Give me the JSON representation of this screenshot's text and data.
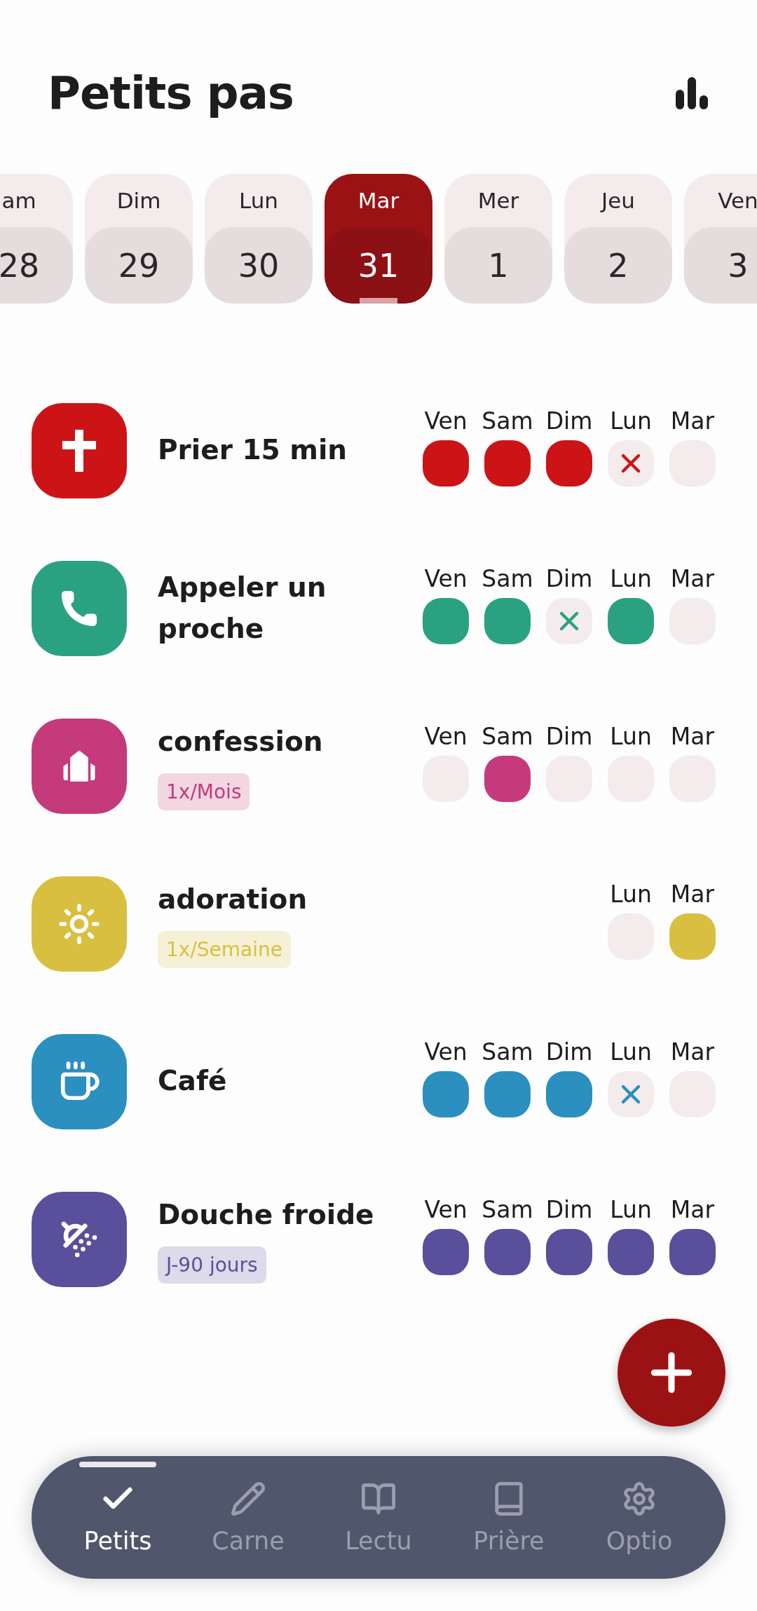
{
  "header": {
    "title": "Petits pas"
  },
  "dates": [
    {
      "day": "am",
      "date": "28",
      "selected": false
    },
    {
      "day": "Dim",
      "date": "29",
      "selected": false
    },
    {
      "day": "Lun",
      "date": "30",
      "selected": false
    },
    {
      "day": "Mar",
      "date": "31",
      "selected": true
    },
    {
      "day": "Mer",
      "date": "1",
      "selected": false
    },
    {
      "day": "Jeu",
      "date": "2",
      "selected": false
    },
    {
      "day": "Ven",
      "date": "3",
      "selected": false
    }
  ],
  "habits": [
    {
      "name": "Prier 15 min",
      "color": "#cc1417",
      "days": [
        {
          "label": "Ven",
          "done": true,
          "missed": false
        },
        {
          "label": "Sam",
          "done": true,
          "missed": false
        },
        {
          "label": "Dim",
          "done": true,
          "missed": false
        },
        {
          "label": "Lun",
          "done": false,
          "missed": true
        },
        {
          "label": "Mar",
          "done": false,
          "missed": false
        }
      ]
    },
    {
      "name": "Appeler un proche",
      "color": "#2aa281",
      "days": [
        {
          "label": "Ven",
          "done": true,
          "missed": false
        },
        {
          "label": "Sam",
          "done": true,
          "missed": false
        },
        {
          "label": "Dim",
          "done": false,
          "missed": true
        },
        {
          "label": "Lun",
          "done": true,
          "missed": false
        },
        {
          "label": "Mar",
          "done": false,
          "missed": false
        }
      ]
    },
    {
      "name": "confession",
      "color": "#c43a7a",
      "tag": "1x/Mois",
      "days": [
        {
          "label": "Ven",
          "done": false,
          "missed": false
        },
        {
          "label": "Sam",
          "done": true,
          "missed": false
        },
        {
          "label": "Dim",
          "done": false,
          "missed": false
        },
        {
          "label": "Lun",
          "done": false,
          "missed": false
        },
        {
          "label": "Mar",
          "done": false,
          "missed": false
        }
      ]
    },
    {
      "name": "adoration",
      "color": "#d9bf3f",
      "tag": "1x/Semaine",
      "days": [
        {
          "label": "Lun",
          "done": false,
          "missed": false
        },
        {
          "label": "Mar",
          "done": true,
          "missed": false
        }
      ]
    },
    {
      "name": "Café",
      "color": "#2b8fbf",
      "days": [
        {
          "label": "Ven",
          "done": true,
          "missed": false
        },
        {
          "label": "Sam",
          "done": true,
          "missed": false
        },
        {
          "label": "Dim",
          "done": true,
          "missed": false
        },
        {
          "label": "Lun",
          "done": false,
          "missed": true
        },
        {
          "label": "Mar",
          "done": false,
          "missed": false
        }
      ]
    },
    {
      "name": "Douche froide",
      "color": "#5a4f9b",
      "tag": "J-90 jours",
      "days": [
        {
          "label": "Ven",
          "done": true,
          "missed": false
        },
        {
          "label": "Sam",
          "done": true,
          "missed": false
        },
        {
          "label": "Dim",
          "done": true,
          "missed": false
        },
        {
          "label": "Lun",
          "done": true,
          "missed": false
        },
        {
          "label": "Mar",
          "done": true,
          "missed": false
        }
      ]
    }
  ],
  "nav": [
    {
      "label": "Petits",
      "selected": true
    },
    {
      "label": "Carne",
      "selected": false
    },
    {
      "label": "Lectu",
      "selected": false
    },
    {
      "label": "Prière",
      "selected": false
    },
    {
      "label": "Optio",
      "selected": false
    }
  ]
}
